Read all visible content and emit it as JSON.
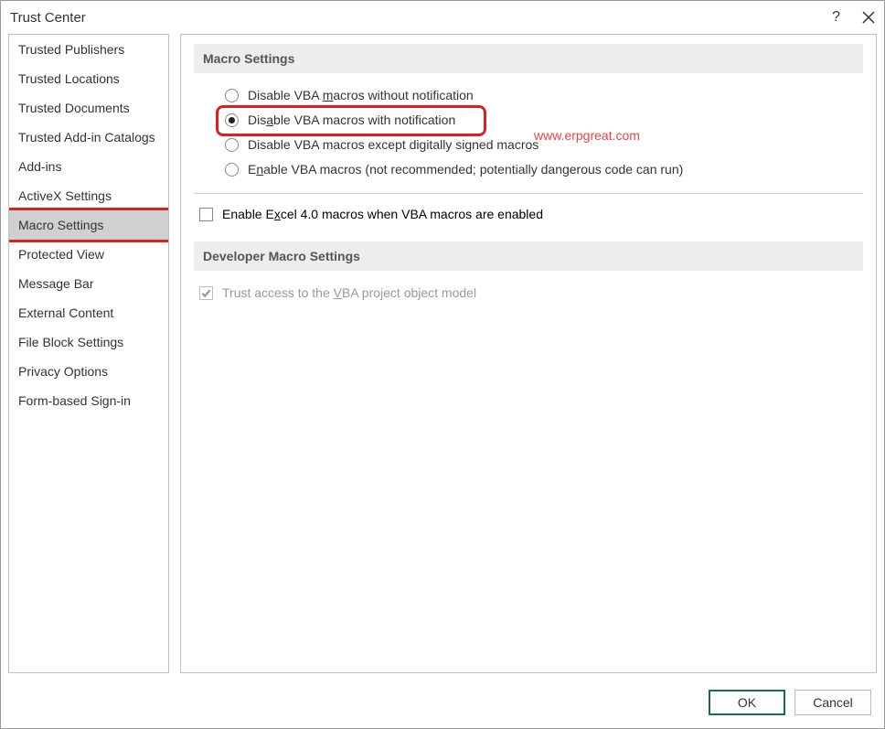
{
  "dialog": {
    "title": "Trust Center"
  },
  "sidebar": {
    "items": [
      {
        "label": "Trusted Publishers",
        "selected": false
      },
      {
        "label": "Trusted Locations",
        "selected": false
      },
      {
        "label": "Trusted Documents",
        "selected": false
      },
      {
        "label": "Trusted Add-in Catalogs",
        "selected": false
      },
      {
        "label": "Add-ins",
        "selected": false
      },
      {
        "label": "ActiveX Settings",
        "selected": false
      },
      {
        "label": "Macro Settings",
        "selected": true,
        "highlight": true
      },
      {
        "label": "Protected View",
        "selected": false
      },
      {
        "label": "Message Bar",
        "selected": false
      },
      {
        "label": "External Content",
        "selected": false
      },
      {
        "label": "File Block Settings",
        "selected": false
      },
      {
        "label": "Privacy Options",
        "selected": false
      },
      {
        "label": "Form-based Sign-in",
        "selected": false
      }
    ]
  },
  "main": {
    "section1_title": "Macro Settings",
    "radios": [
      {
        "prefix": "Disable VBA ",
        "u": "m",
        "suffix": "acros without notification",
        "checked": false
      },
      {
        "prefix": "Dis",
        "u": "a",
        "suffix": "ble VBA macros with notification",
        "checked": true,
        "highlight": true
      },
      {
        "prefix": "Disable VBA macros except digitally si",
        "u": "g",
        "suffix": "ned macros",
        "checked": false
      },
      {
        "prefix": "E",
        "u": "n",
        "suffix": "able VBA macros (not recommended; potentially dangerous code can run)",
        "checked": false
      }
    ],
    "checkbox1": {
      "prefix": "Enable E",
      "u": "x",
      "suffix": "cel 4.0 macros when VBA macros are enabled",
      "checked": false
    },
    "section2_title": "Developer Macro Settings",
    "checkbox2": {
      "prefix": "Trust access to the ",
      "u": "V",
      "suffix": "BA project object model",
      "checked": true,
      "disabled": true
    }
  },
  "watermark": {
    "text": "www.erpgreat.com"
  },
  "buttons": {
    "ok": "OK",
    "cancel": "Cancel"
  }
}
